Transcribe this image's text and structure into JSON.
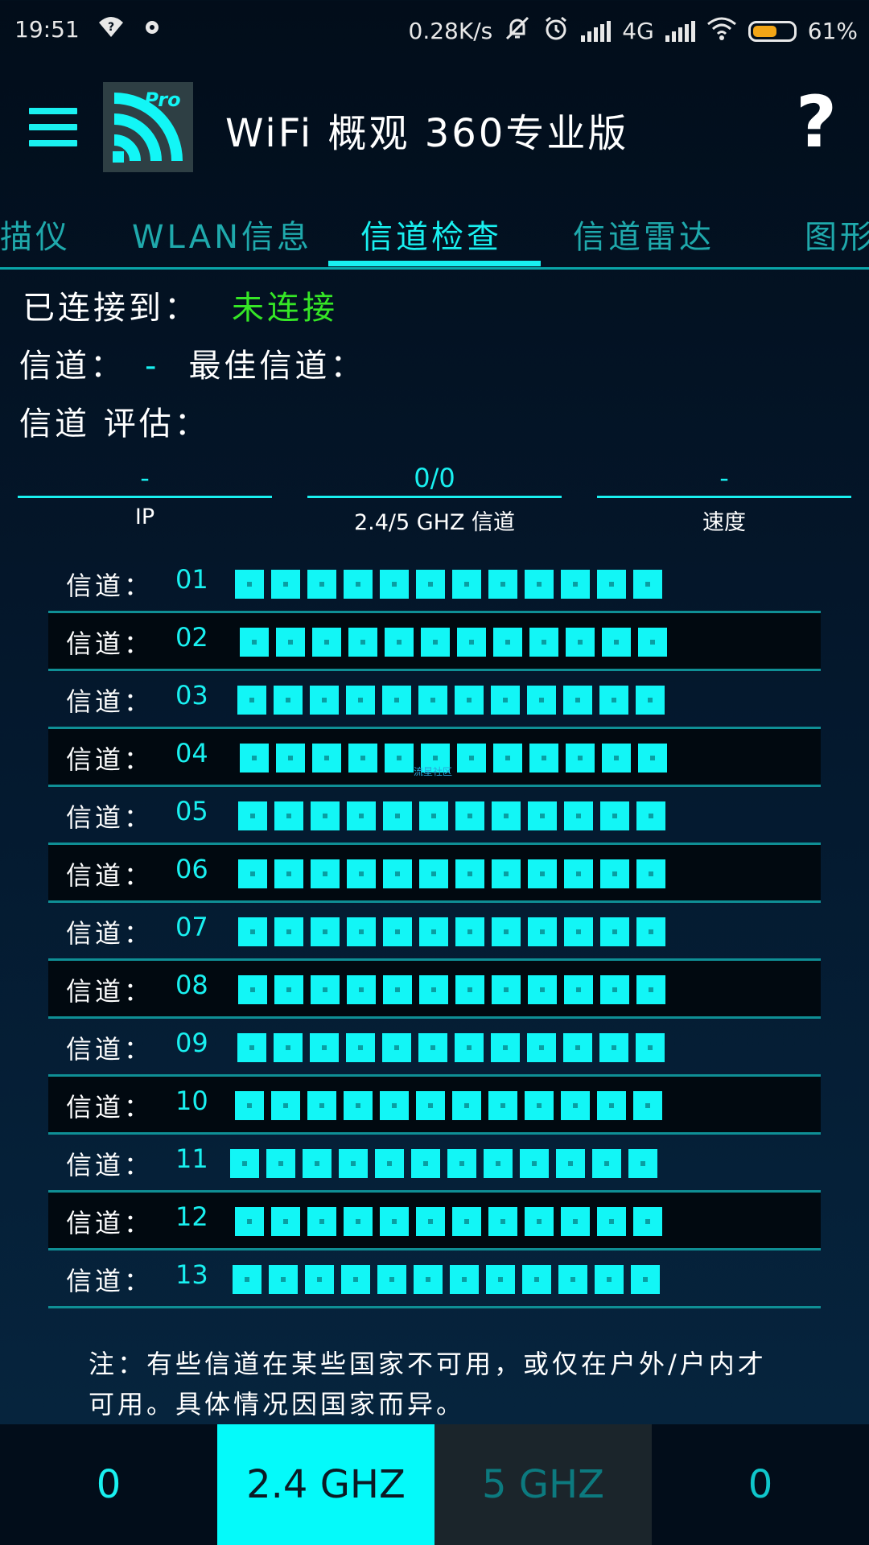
{
  "status_bar": {
    "time": "19:51",
    "left_icons": [
      "question-icon",
      "notification-dot-icon"
    ],
    "network_speed": "0.28K/s",
    "network_type": "4G",
    "battery": "61%",
    "battery_level": 0.61
  },
  "app_bar": {
    "logo_badge": "Pro",
    "title": "WiFi 概观 360专业版",
    "help": "?"
  },
  "tabs": [
    {
      "label": "描仪"
    },
    {
      "label": "WLAN信息"
    },
    {
      "label": "信道检查",
      "active": true
    },
    {
      "label": "信道雷达"
    },
    {
      "label": "图形"
    }
  ],
  "info": {
    "connected_label": "已连接到：",
    "connected_value": "未连接",
    "channel_label": "信道：",
    "channel_value": "-",
    "best_channel_label": "最佳信道：",
    "rating_label": "信道  评估："
  },
  "stats": [
    {
      "value": "-",
      "label": "IP"
    },
    {
      "value": "0/0",
      "label": "2.4/5 GHZ 信道"
    },
    {
      "value": "-",
      "label": "速度"
    }
  ],
  "channel_prefix": "信道：",
  "channels": [
    "01",
    "02",
    "03",
    "04",
    "05",
    "06",
    "07",
    "08",
    "09",
    "10",
    "11",
    "12",
    "13"
  ],
  "squares_per_channel": 12,
  "watermark": "流星社区",
  "note": "注：有些信道在某些国家不可用，或仅在户外/户内才可用。具体情况因国家而异。",
  "bottom_bar": {
    "left_count": "0",
    "band_24": "2.4 GHZ",
    "band_5": "5 GHZ",
    "right_count": "0"
  },
  "colors": {
    "accent": "#19f0f0",
    "connected_status": "#35e626",
    "battery": "#f2a516"
  }
}
